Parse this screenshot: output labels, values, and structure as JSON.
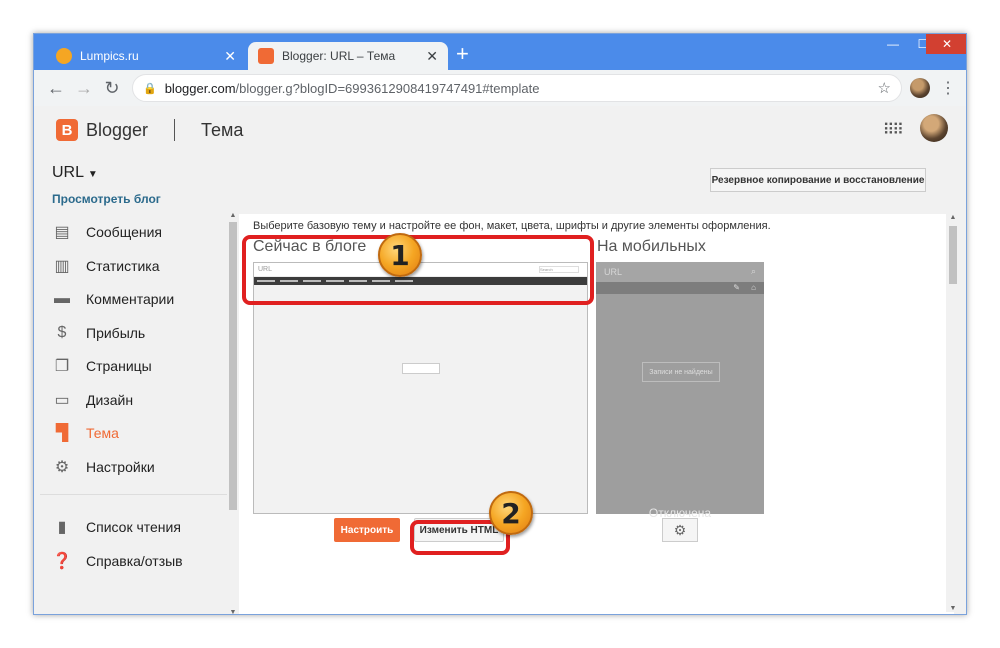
{
  "browser": {
    "tabs": [
      {
        "title": "Lumpics.ru",
        "favicon_color": "#f5a623"
      },
      {
        "title": "Blogger: URL – Тема",
        "favicon_color": "#f06a35"
      }
    ],
    "url_host": "blogger.com",
    "url_path": "/blogger.g?blogID=6993612908419747491#template",
    "close_tab": "✕",
    "new_tab": "+"
  },
  "header": {
    "logo_letter": "B",
    "app_name": "Blogger",
    "page_title": "Тема"
  },
  "sidebar": {
    "blog_name": "URL",
    "view_blog": "Просмотреть блог",
    "items": [
      {
        "label": "Сообщения",
        "icon": "posts-icon"
      },
      {
        "label": "Статистика",
        "icon": "stats-icon"
      },
      {
        "label": "Комментарии",
        "icon": "comments-icon"
      },
      {
        "label": "Прибыль",
        "icon": "dollar-icon"
      },
      {
        "label": "Страницы",
        "icon": "pages-icon"
      },
      {
        "label": "Дизайн",
        "icon": "layout-icon"
      },
      {
        "label": "Тема",
        "icon": "theme-icon",
        "active": true
      },
      {
        "label": "Настройки",
        "icon": "gear-icon"
      }
    ],
    "secondary_items": [
      {
        "label": "Список чтения",
        "icon": "bookmark-icon"
      },
      {
        "label": "Справка/отзыв",
        "icon": "help-icon"
      }
    ]
  },
  "main": {
    "backup_button": "Резервное копирование и восстановление",
    "intro": "Выберите базовую тему и настройте ее фон, макет, цвета, шрифты и другие элементы оформления.",
    "current_heading": "Сейчас в блоге",
    "mobile_heading": "На мобильных",
    "customize_button": "Настроить",
    "edit_html_button": "Изменить HTML",
    "desktop_preview_title": "URL",
    "desktop_preview_search": "Search",
    "mobile_preview_title": "URL",
    "mobile_not_found": "Записи не найдены",
    "mobile_off_label": "Отключена"
  },
  "annotations": {
    "marker1": "1",
    "marker2": "2",
    "color": "#e02020"
  },
  "colors": {
    "accent": "#f06a35",
    "chrome": "#4b8bea",
    "link": "#2b6a8c"
  }
}
